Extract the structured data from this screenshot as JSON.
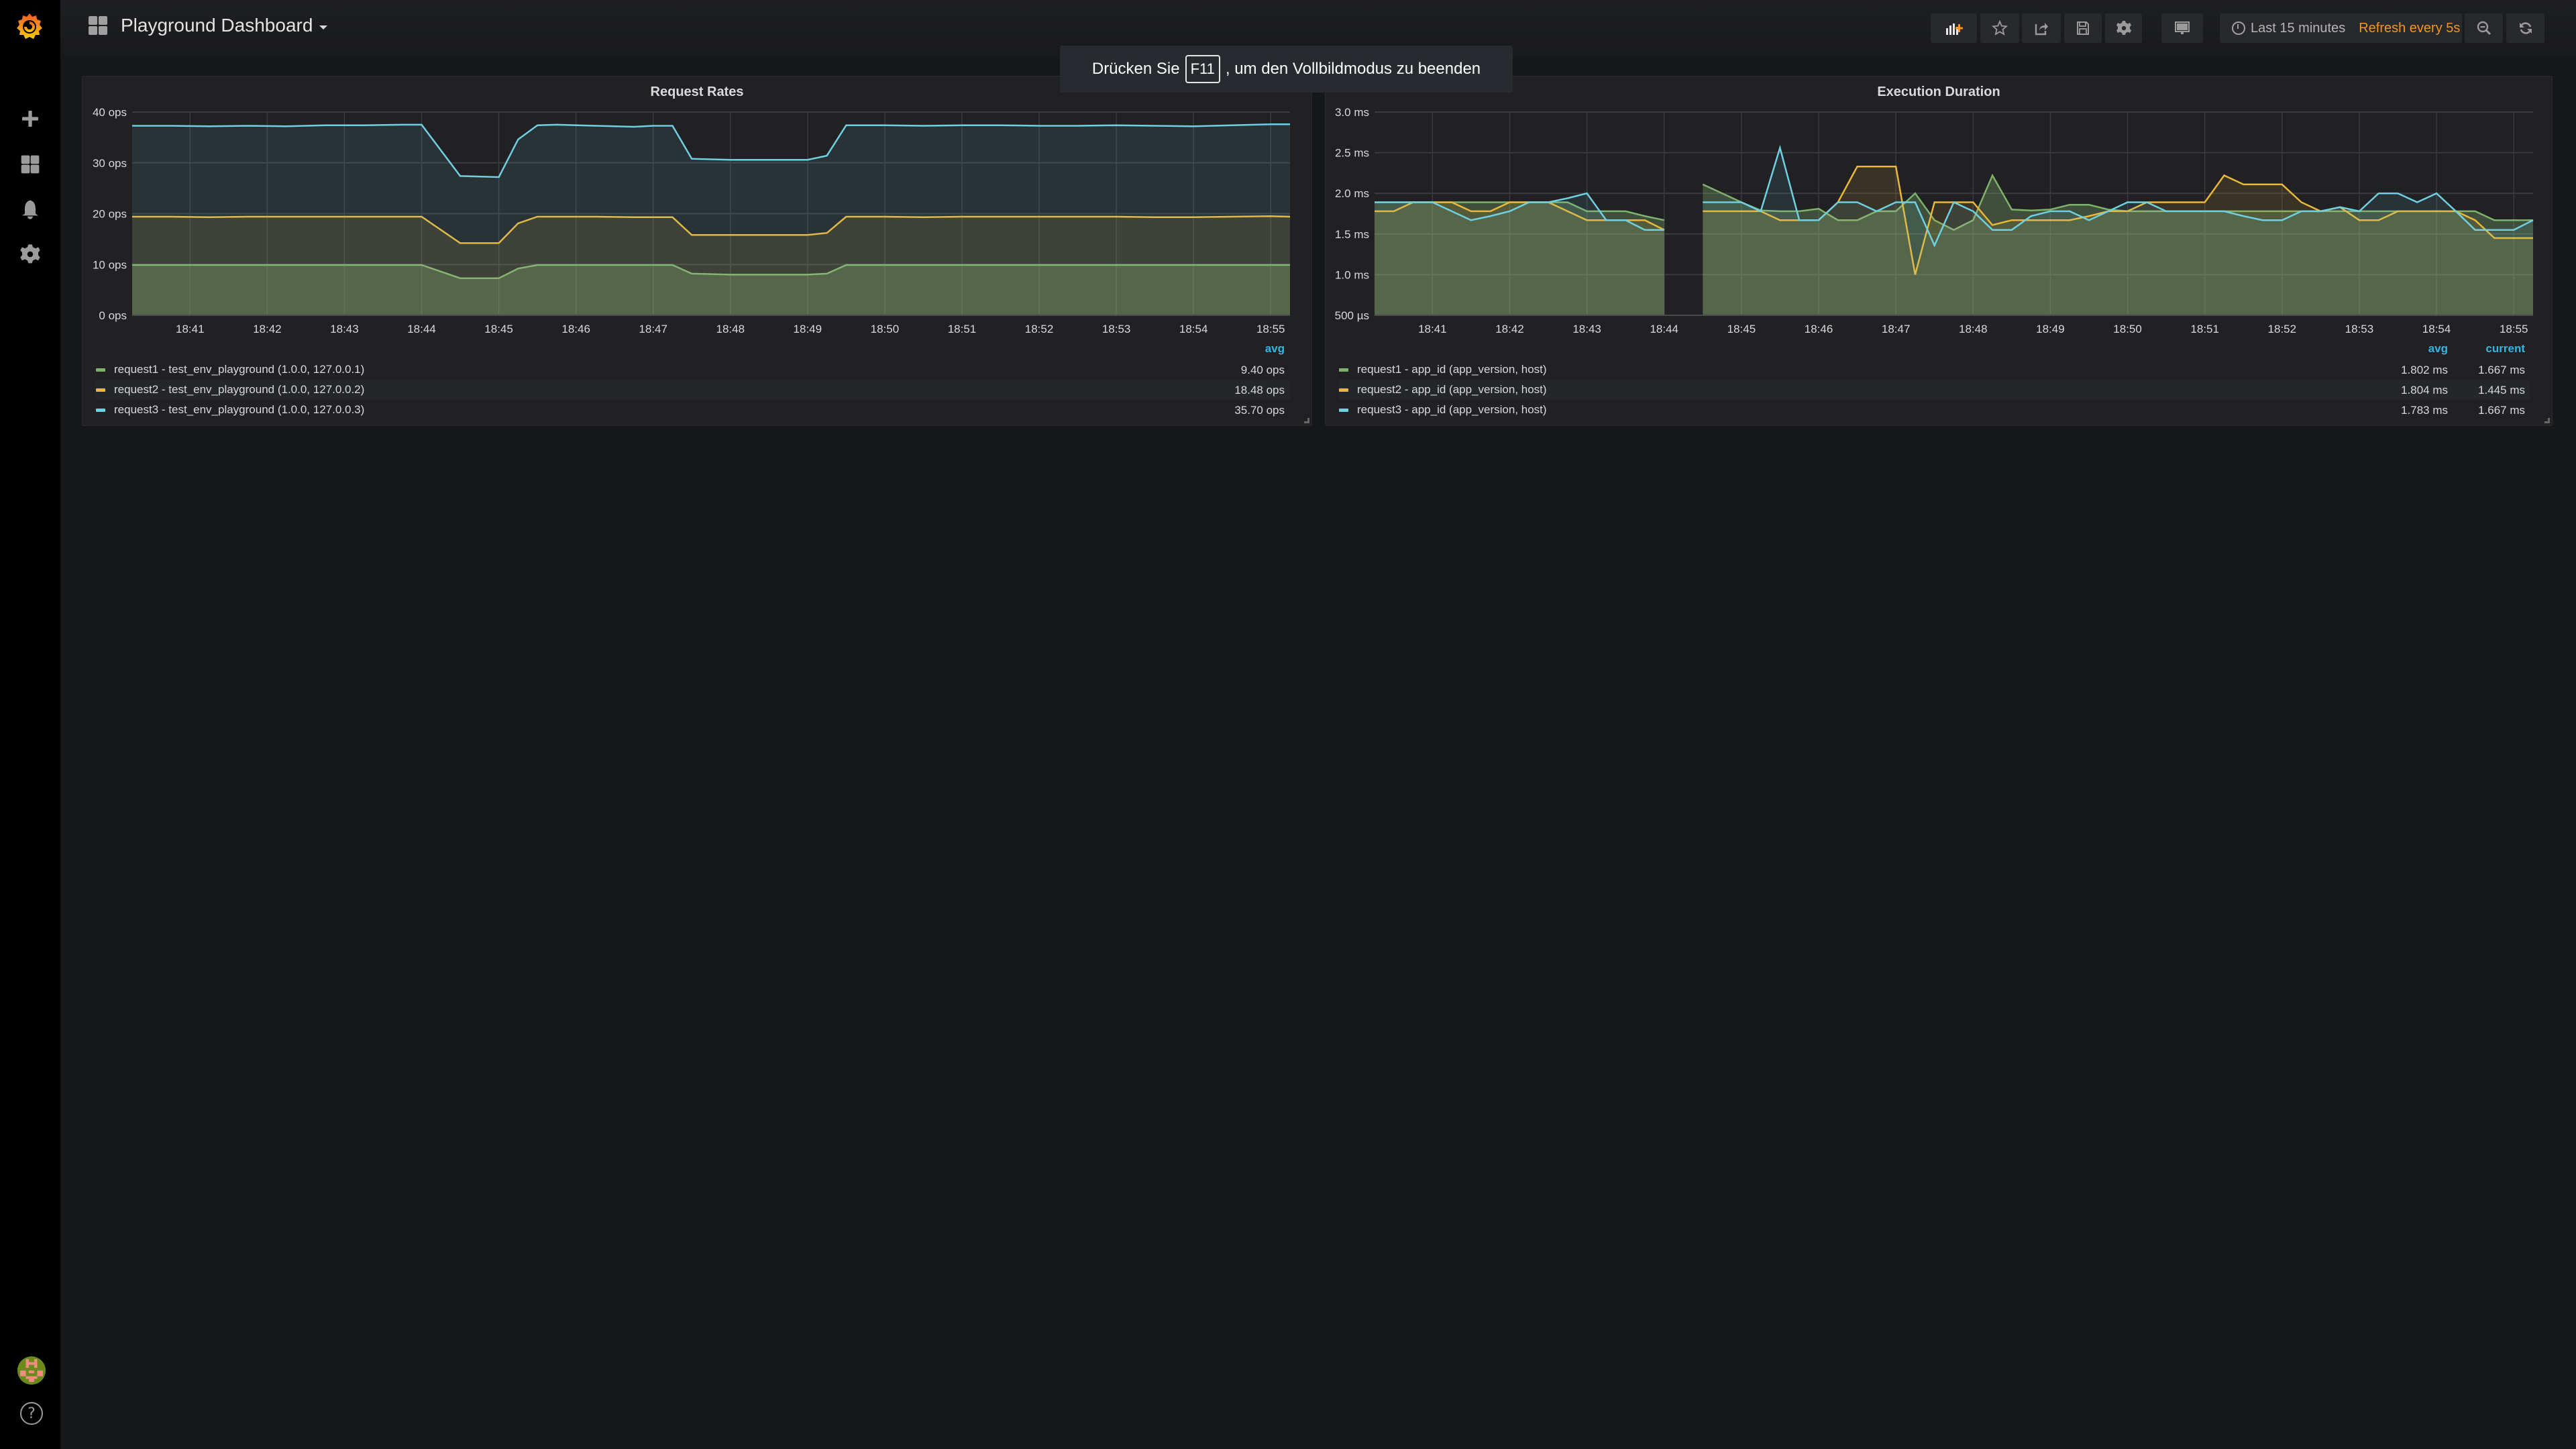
{
  "sidebar": {
    "items": [
      {
        "name": "create",
        "icon": "plus-icon"
      },
      {
        "name": "dashboards",
        "icon": "dashboards-icon"
      },
      {
        "name": "alerting",
        "icon": "bell-icon"
      },
      {
        "name": "configuration",
        "icon": "gear-icon"
      }
    ],
    "help_label": "?"
  },
  "header": {
    "dashboard_title": "Playground Dashboard",
    "buttons": [
      "add-panel",
      "star",
      "share",
      "save",
      "settings",
      "tv-mode"
    ],
    "time_range": "Last 15 minutes",
    "refresh": "Refresh every 5s",
    "colors": {
      "refresh": "#f7941e",
      "add_panel_accent": "#f7941e"
    }
  },
  "banner": {
    "prefix": "Drücken Sie",
    "key": "F11",
    "suffix": ", um den Vollbildmodus zu beenden"
  },
  "colors": {
    "request1": "#7eb26d",
    "request2": "#eab839",
    "request3": "#6ed0e0",
    "legend_header": "#33b5e5"
  },
  "chart_data": [
    {
      "type": "area",
      "title": "Request Rates",
      "x": [
        "18:40:15",
        "18:40:45",
        "18:41:15",
        "18:41:45",
        "18:42:15",
        "18:42:45",
        "18:43:15",
        "18:43:45",
        "18:44:00",
        "18:44:30",
        "18:45:00",
        "18:45:15",
        "18:45:30",
        "18:45:45",
        "18:46:15",
        "18:46:45",
        "18:47:00",
        "18:47:15",
        "18:47:30",
        "18:48:00",
        "18:48:30",
        "18:49:00",
        "18:49:15",
        "18:49:30",
        "18:50:00",
        "18:50:30",
        "18:51:00",
        "18:51:30",
        "18:52:00",
        "18:52:30",
        "18:53:00",
        "18:53:30",
        "18:54:00",
        "18:54:30",
        "18:55:00",
        "18:55:15"
      ],
      "xticks": [
        "18:41",
        "18:42",
        "18:43",
        "18:44",
        "18:45",
        "18:46",
        "18:47",
        "18:48",
        "18:49",
        "18:50",
        "18:51",
        "18:52",
        "18:53",
        "18:54",
        "18:55"
      ],
      "yticks": [
        "0 ops",
        "10 ops",
        "20 ops",
        "30 ops",
        "40 ops"
      ],
      "ylim": [
        0,
        40
      ],
      "ylabel": "ops",
      "grid": true,
      "legend": {
        "position": "bottom",
        "columns": [
          "avg"
        ]
      },
      "series": [
        {
          "name": "request1 - test_env_playground (1.0.0, 127.0.0.1)",
          "avg": "9.40 ops",
          "values": [
            9.9,
            9.9,
            9.9,
            9.9,
            9.9,
            9.9,
            9.9,
            9.9,
            9.9,
            7.3,
            7.3,
            9.2,
            9.9,
            9.9,
            9.9,
            9.9,
            9.9,
            9.9,
            8.2,
            8.0,
            8.0,
            8.0,
            8.2,
            9.9,
            9.9,
            9.9,
            9.9,
            9.9,
            9.9,
            9.9,
            9.9,
            9.9,
            9.9,
            9.9,
            9.9,
            9.9
          ]
        },
        {
          "name": "request2 - test_env_playground (1.0.0, 127.0.0.2)",
          "avg": "18.48 ops",
          "values": [
            19.4,
            19.4,
            19.3,
            19.4,
            19.4,
            19.4,
            19.4,
            19.4,
            19.4,
            14.2,
            14.2,
            18.1,
            19.4,
            19.4,
            19.4,
            19.3,
            19.3,
            19.3,
            15.8,
            15.8,
            15.8,
            15.8,
            16.2,
            19.4,
            19.4,
            19.3,
            19.4,
            19.4,
            19.4,
            19.4,
            19.4,
            19.3,
            19.3,
            19.4,
            19.5,
            19.4
          ]
        },
        {
          "name": "request3 - test_env_playground (1.0.0, 127.0.0.3)",
          "avg": "35.70 ops",
          "values": [
            37.3,
            37.3,
            37.2,
            37.3,
            37.2,
            37.4,
            37.4,
            37.5,
            37.5,
            27.4,
            27.2,
            34.6,
            37.4,
            37.5,
            37.3,
            37.1,
            37.3,
            37.3,
            30.8,
            30.6,
            30.6,
            30.6,
            31.4,
            37.4,
            37.4,
            37.3,
            37.4,
            37.4,
            37.3,
            37.3,
            37.4,
            37.3,
            37.2,
            37.4,
            37.6,
            37.6
          ]
        }
      ]
    },
    {
      "type": "area",
      "title": "Execution Duration",
      "x": [
        "18:40:15",
        "18:40:30",
        "18:40:45",
        "18:41:00",
        "18:41:15",
        "18:41:30",
        "18:41:45",
        "18:42:00",
        "18:42:15",
        "18:42:30",
        "18:42:45",
        "18:43:00",
        "18:43:15",
        "18:43:30",
        "18:43:45",
        "18:44:00",
        "18:44:30",
        "18:45:00",
        "18:45:15",
        "18:45:30",
        "18:45:45",
        "18:46:00",
        "18:46:15",
        "18:46:30",
        "18:46:45",
        "18:47:00",
        "18:47:15",
        "18:47:30",
        "18:47:45",
        "18:48:00",
        "18:48:15",
        "18:48:30",
        "18:48:45",
        "18:49:00",
        "18:49:15",
        "18:49:30",
        "18:49:45",
        "18:50:00",
        "18:50:15",
        "18:50:30",
        "18:50:45",
        "18:51:00",
        "18:51:15",
        "18:51:30",
        "18:51:45",
        "18:52:00",
        "18:52:15",
        "18:52:30",
        "18:52:45",
        "18:53:00",
        "18:53:15",
        "18:53:30",
        "18:53:45",
        "18:54:00",
        "18:54:15",
        "18:54:30",
        "18:54:45",
        "18:55:00",
        "18:55:15"
      ],
      "xticks": [
        "18:41",
        "18:42",
        "18:43",
        "18:44",
        "18:45",
        "18:46",
        "18:47",
        "18:48",
        "18:49",
        "18:50",
        "18:51",
        "18:52",
        "18:53",
        "18:54",
        "18:55"
      ],
      "yticks": [
        "500 µs",
        "1.0 ms",
        "1.5 ms",
        "2.0 ms",
        "2.5 ms",
        "3.0 ms"
      ],
      "ylim": [
        0.5,
        3.0
      ],
      "ylabel": "ms",
      "grid": true,
      "gap": [
        "18:44:00",
        "18:44:30"
      ],
      "legend": {
        "position": "bottom",
        "columns": [
          "avg",
          "current"
        ]
      },
      "series": [
        {
          "name": "request1 - app_id (app_version, host)",
          "avg": "1.802 ms",
          "current": "1.667 ms",
          "values": [
            1.89,
            1.89,
            1.89,
            1.89,
            1.89,
            1.89,
            1.89,
            1.89,
            1.89,
            1.89,
            1.89,
            1.78,
            1.78,
            1.78,
            1.72,
            1.67,
            2.11,
            1.89,
            1.79,
            1.78,
            1.78,
            1.81,
            1.67,
            1.67,
            1.78,
            1.78,
            2.0,
            1.67,
            1.55,
            1.67,
            2.22,
            1.8,
            1.79,
            1.8,
            1.86,
            1.86,
            1.8,
            1.78,
            1.78,
            1.78,
            1.78,
            1.78,
            1.78,
            1.78,
            1.78,
            1.78,
            1.78,
            1.78,
            1.78,
            1.78,
            1.78,
            1.78,
            1.78,
            1.78,
            1.78,
            1.78,
            1.67,
            1.67,
            1.67
          ]
        },
        {
          "name": "request2 - app_id (app_version, host)",
          "avg": "1.804 ms",
          "current": "1.445 ms",
          "values": [
            1.78,
            1.78,
            1.89,
            1.89,
            1.89,
            1.78,
            1.78,
            1.89,
            1.89,
            1.89,
            1.78,
            1.67,
            1.67,
            1.67,
            1.67,
            1.55,
            1.78,
            1.78,
            1.78,
            1.67,
            1.67,
            1.67,
            1.89,
            2.33,
            2.33,
            2.33,
            1.0,
            1.89,
            1.89,
            1.89,
            1.61,
            1.67,
            1.67,
            1.67,
            1.67,
            1.72,
            1.78,
            1.78,
            1.89,
            1.89,
            1.89,
            1.89,
            2.22,
            2.11,
            2.11,
            2.11,
            1.89,
            1.78,
            1.83,
            1.67,
            1.67,
            1.78,
            1.78,
            1.78,
            1.78,
            1.67,
            1.45,
            1.45,
            1.45
          ]
        },
        {
          "name": "request3 - app_id (app_version, host)",
          "avg": "1.783 ms",
          "current": "1.667 ms",
          "values": [
            1.89,
            1.89,
            1.89,
            1.89,
            1.78,
            1.67,
            1.72,
            1.78,
            1.89,
            1.89,
            1.94,
            2.0,
            1.67,
            1.67,
            1.55,
            1.55,
            1.89,
            1.89,
            1.78,
            2.56,
            1.67,
            1.67,
            1.89,
            1.89,
            1.78,
            1.89,
            1.89,
            1.36,
            1.89,
            1.78,
            1.55,
            1.55,
            1.72,
            1.78,
            1.78,
            1.67,
            1.78,
            1.89,
            1.89,
            1.78,
            1.78,
            1.78,
            1.78,
            1.72,
            1.67,
            1.67,
            1.78,
            1.78,
            1.83,
            1.78,
            2.0,
            2.0,
            1.89,
            2.0,
            1.78,
            1.55,
            1.55,
            1.55,
            1.67
          ]
        }
      ]
    }
  ]
}
